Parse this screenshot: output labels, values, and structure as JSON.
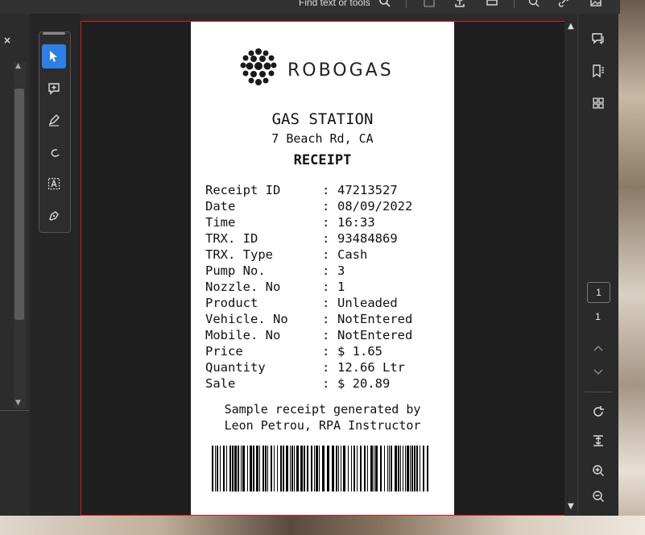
{
  "toolbar": {
    "find_label": "Find text or tools",
    "icons": [
      "search-icon",
      "save-icon",
      "share-icon",
      "print-icon",
      "zoom-tool-icon",
      "link-icon",
      "image-icon"
    ]
  },
  "left_panel": {
    "close_glyph": "×"
  },
  "tools": [
    "select-pointer-icon",
    "add-comment-icon",
    "highlight-pen-icon",
    "draw-freeform-icon",
    "text-recognition-icon",
    "sign-icon"
  ],
  "receipt": {
    "brand": "ROBOGAS",
    "title": "GAS STATION",
    "address": "7 Beach Rd, CA",
    "heading": "RECEIPT",
    "rows": [
      {
        "key": "Receipt ID",
        "value": "47213527"
      },
      {
        "key": "Date",
        "value": "08/09/2022"
      },
      {
        "key": "Time",
        "value": "16:33"
      },
      {
        "key": "TRX. ID",
        "value": "93484869"
      },
      {
        "key": "TRX. Type",
        "value": "Cash"
      },
      {
        "key": "Pump No.",
        "value": "3"
      },
      {
        "key": "Nozzle. No",
        "value": "1"
      },
      {
        "key": "Product",
        "value": "Unleaded"
      },
      {
        "key": "Vehicle. No",
        "value": "NotEntered"
      },
      {
        "key": "Mobile. No",
        "value": "NotEntered"
      },
      {
        "key": "Price",
        "value": "$ 1.65"
      },
      {
        "key": "Quantity",
        "value": "12.66 Ltr"
      },
      {
        "key": "Sale",
        "value": "$ 20.89"
      }
    ],
    "separator": ":",
    "footer_line1": "Sample receipt generated by",
    "footer_line2": "Leon Petrou, RPA Instructor"
  },
  "page_nav": {
    "current_page": "1",
    "total_pages": "1"
  },
  "right_tools": [
    "comment-panel-icon",
    "bookmark-icon",
    "thumbnails-icon"
  ],
  "view_tools": [
    "rotate-icon",
    "fit-page-icon",
    "zoom-in-icon",
    "zoom-out-icon"
  ],
  "colors": {
    "accent": "#2d7ee6",
    "selection_border": "#e01818",
    "page_bg": "#ffffff"
  }
}
